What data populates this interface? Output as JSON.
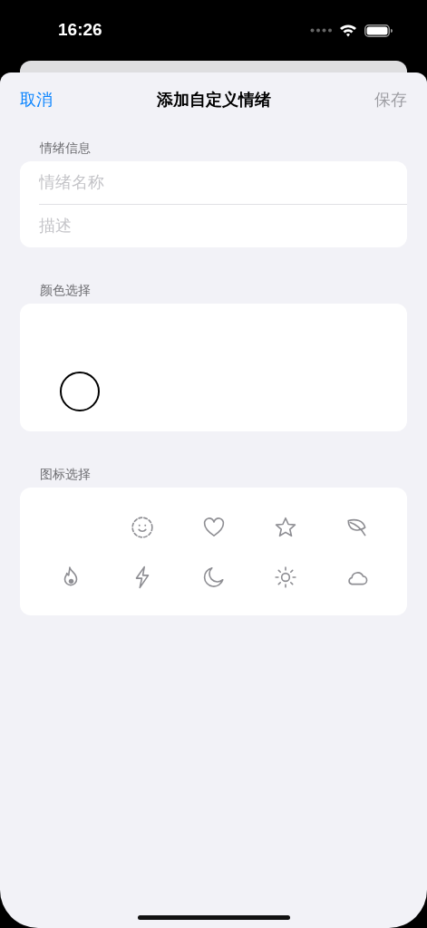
{
  "status_bar": {
    "time": "16:26"
  },
  "nav": {
    "cancel": "取消",
    "title": "添加自定义情绪",
    "save": "保存",
    "save_disabled": true
  },
  "info_section": {
    "header": "情绪信息",
    "fields": [
      {
        "placeholder": "情绪名称"
      },
      {
        "placeholder": "描述"
      }
    ]
  },
  "color_section": {
    "header": "颜色选择",
    "swatches": [
      {
        "color": "#ffffff",
        "selected": true
      }
    ]
  },
  "icon_section": {
    "header": "图标选择",
    "icons": [
      {
        "kind": "smiley"
      },
      {
        "kind": "heart"
      },
      {
        "kind": "star"
      },
      {
        "kind": "leaf"
      },
      {
        "kind": "flame"
      },
      {
        "kind": "bolt"
      },
      {
        "kind": "moon"
      },
      {
        "kind": "sun"
      },
      {
        "kind": "cloud"
      }
    ]
  }
}
